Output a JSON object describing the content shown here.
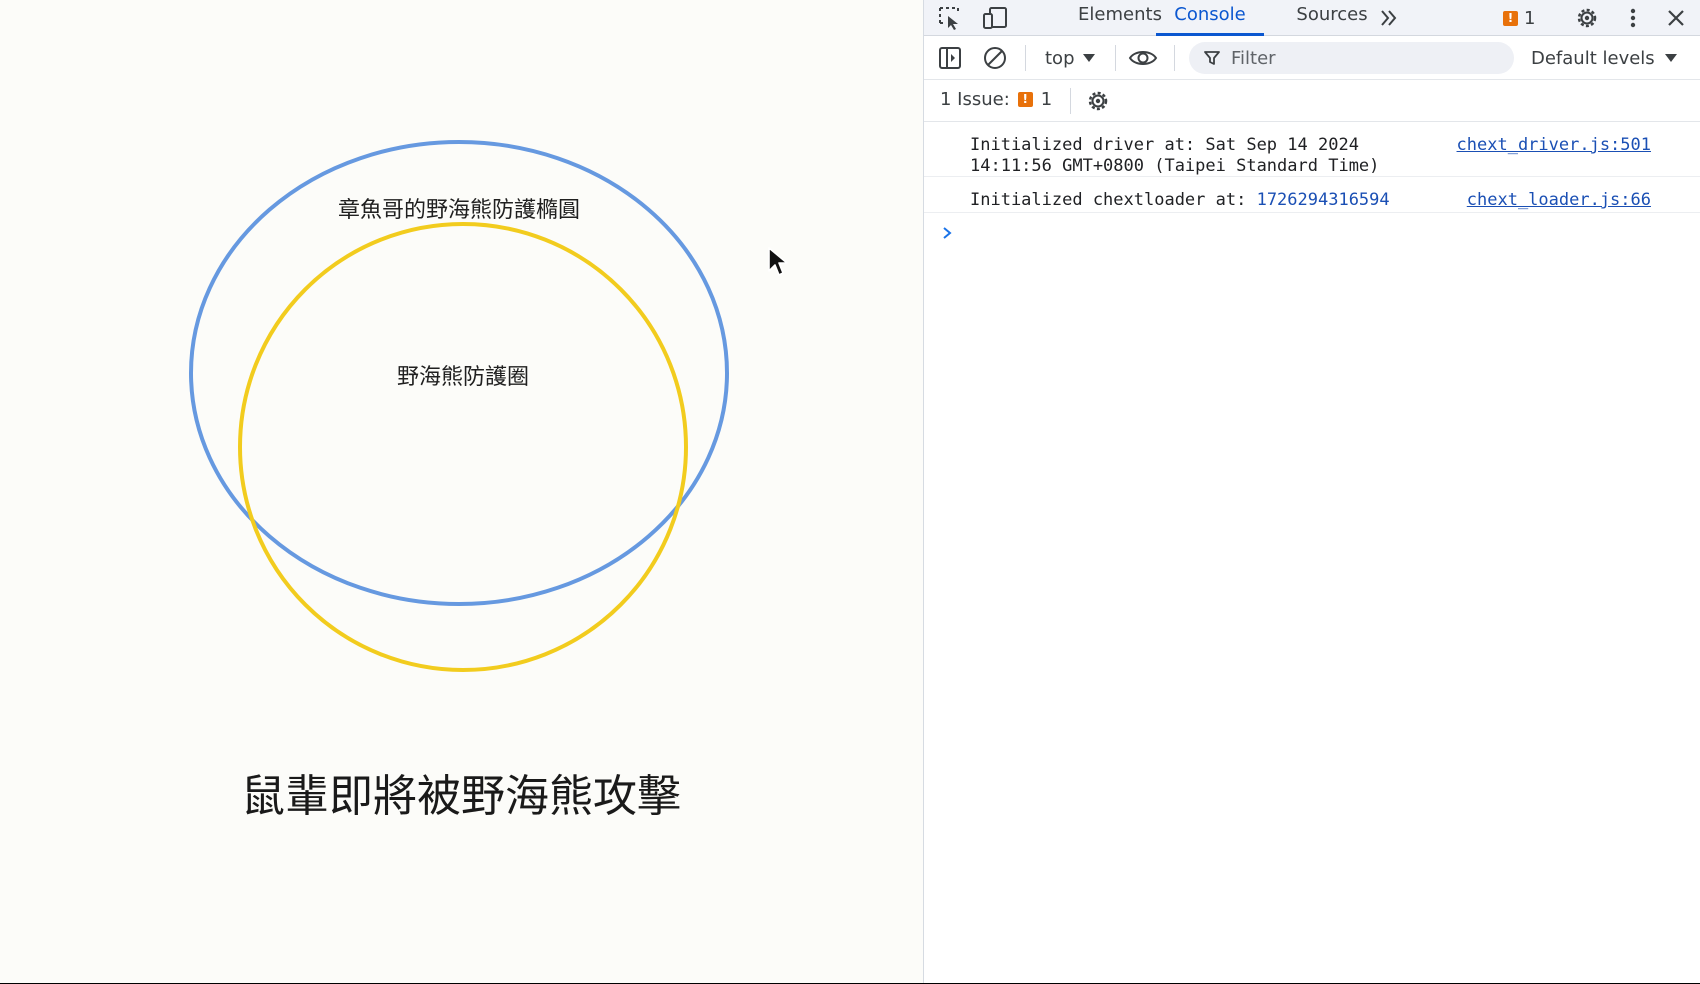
{
  "page": {
    "ellipse_label": "章魚哥的野海熊防護橢圓",
    "circle_label": "野海熊防護圈",
    "heading": "鼠輩即將被野海熊攻擊",
    "ellipse_color": "#6699e0",
    "circle_color": "#f2cc1e",
    "background": "#fcfcf9"
  },
  "devtools": {
    "icons": {
      "inspect": "inspect-element-icon",
      "device": "device-toolbar-icon",
      "more_tabs": "more-tabs-chevron-icon",
      "settings": "settings-gear-icon",
      "menu": "kebab-menu-icon",
      "close": "close-icon"
    },
    "tabs": [
      {
        "label": "Elements",
        "active": false
      },
      {
        "label": "Console",
        "active": true
      },
      {
        "label": "Sources",
        "active": false
      }
    ],
    "issue_count": "1",
    "toolbar": {
      "context": "top",
      "filter_placeholder": "Filter",
      "levels": "Default levels"
    },
    "issues_bar": {
      "label": "1 Issue:",
      "count": "1"
    },
    "console": {
      "messages": [
        {
          "line1": "Initialized driver at: Sat Sep 14 2024",
          "line2": "14:11:56 GMT+0800 (Taipei Standard Time)",
          "source": "chext_driver.js:501"
        },
        {
          "prefix": "Initialized chextloader at: ",
          "value": "1726294316594",
          "source": "chext_loader.js:66"
        }
      ]
    },
    "accent_color": "#0b57d0",
    "warning_color": "#e8710a"
  }
}
